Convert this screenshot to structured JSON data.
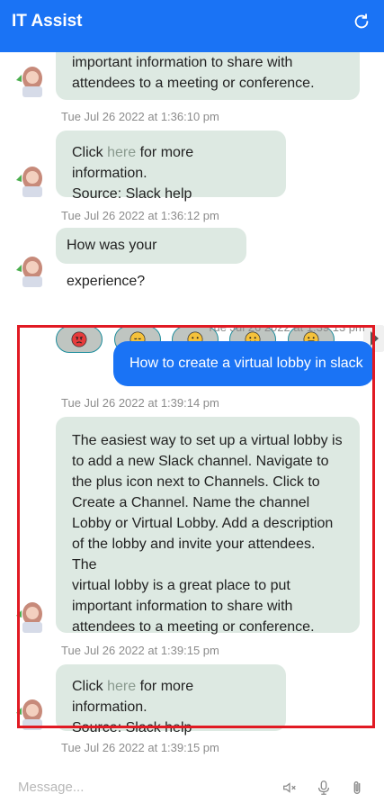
{
  "header": {
    "title": "IT Assist",
    "refresh_icon": "refresh-icon"
  },
  "messages": {
    "bot_1_lines": [
      "important information to share with",
      "attendees to a meeting or conference."
    ],
    "ts_1": "Tue Jul 26 2022 at 1:36:10 pm",
    "bot_2": {
      "pre": "Click ",
      "link": "here",
      "post": " for more information.",
      "line2": "Source: Slack help"
    },
    "ts_2": "Tue Jul 26 2022 at 1:36:12 pm",
    "bot_3": "How was your experience?",
    "feedback": [
      {
        "icon": "angry-face-icon",
        "color": "#e63b3b"
      },
      {
        "icon": "disappointed-face-icon",
        "color": "#f5c23b"
      },
      {
        "icon": "neutral-face-icon",
        "color": "#f5c23b"
      },
      {
        "icon": "slightly-smiling-face-icon",
        "color": "#f5c23b"
      },
      {
        "icon": "grinning-face-icon",
        "color": "#f5c23b"
      }
    ],
    "ts_user": "Tue Jul 26 2022 at 1:39:13 pm",
    "user_1": "How to create a virtual lobby in slack",
    "ts_3": "Tue Jul 26 2022 at 1:39:14 pm",
    "bot_4_lines": [
      "The easiest way to set up a virtual lobby is",
      "to add a new Slack channel. Navigate to",
      "the plus icon next to Channels. Click to",
      "Create a Channel. Name the channel",
      "Lobby or Virtual Lobby. Add a description",
      "of the lobby and invite your attendees. The",
      "virtual lobby is a great place to put",
      "important information to share with",
      "attendees to a meeting or conference."
    ],
    "ts_4": "Tue Jul 26 2022 at 1:39:15 pm",
    "bot_5": {
      "pre": "Click ",
      "link": "here",
      "post": " for more information.",
      "line2": "Source: Slack help"
    },
    "ts_5": "Tue Jul 26 2022 at 1:39:15 pm"
  },
  "composer": {
    "placeholder": "Message...",
    "icons": [
      "mute-speaker-icon",
      "microphone-icon",
      "paperclip-icon"
    ]
  },
  "colors": {
    "accent": "#1a73f5",
    "bot_bubble": "#dde9e2",
    "highlight": "#e11a23"
  }
}
